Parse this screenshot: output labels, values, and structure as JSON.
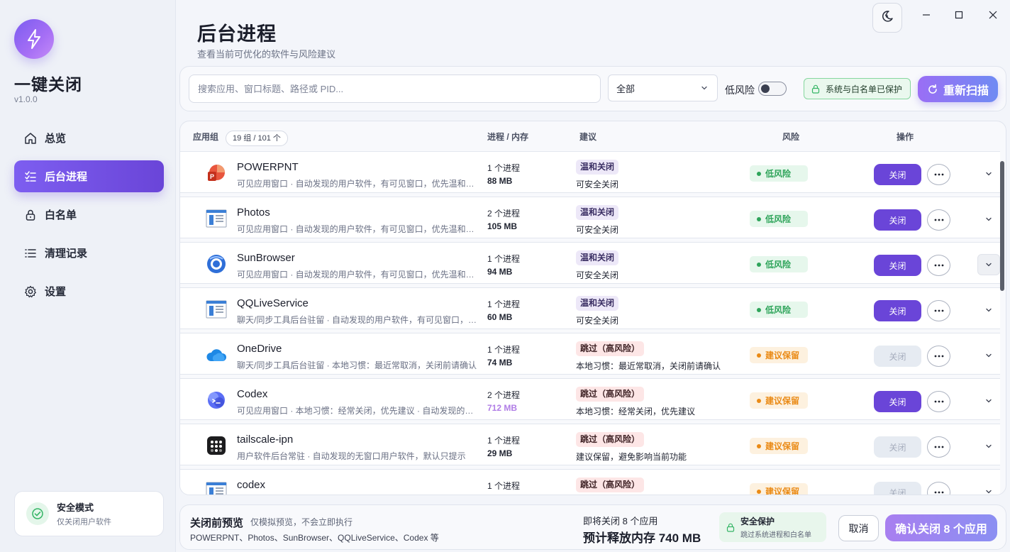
{
  "app": {
    "name": "一键关闭",
    "version": "v1.0.0"
  },
  "nav": [
    {
      "label": "总览",
      "icon": "home-icon",
      "active": false
    },
    {
      "label": "后台进程",
      "icon": "process-list-icon",
      "active": true
    },
    {
      "label": "白名单",
      "icon": "lock-icon",
      "active": false
    },
    {
      "label": "清理记录",
      "icon": "list-icon",
      "active": false
    },
    {
      "label": "设置",
      "icon": "gear-icon",
      "active": false
    }
  ],
  "safe_mode": {
    "title": "安全模式",
    "subtitle": "仅关闭用户软件"
  },
  "header": {
    "title": "后台进程",
    "subtitle": "查看当前可优化的软件与风险建议"
  },
  "filter": {
    "search_placeholder": "搜索应用、窗口标题、路径或 PID...",
    "category_selected": "全部",
    "low_risk_label": "低风险",
    "low_risk_enabled": false,
    "protection_badge": "系统与白名单已保护",
    "rescan_label": "重新扫描"
  },
  "table": {
    "headers": {
      "app_group": "应用组",
      "count": "19 组 / 101 个",
      "proc_mem": "进程 / 内存",
      "suggestion": "建议",
      "risk": "风险",
      "action": "操作"
    },
    "close_label": "关闭",
    "rows": [
      {
        "name": "POWERPNT",
        "icon": "powerpoint-icon",
        "desc": "可见应用窗口 · 自动发现的用户软件，有可见窗口，优先温和关闭",
        "procs": "1 个进程",
        "mem": "88 MB",
        "mem_highlight": false,
        "suggestion": "温和关闭",
        "suggestion_type": "gentle",
        "note": "可安全关闭",
        "risk": "低风险",
        "risk_type": "low",
        "close_enabled": true
      },
      {
        "name": "Photos",
        "icon": "app-window-icon",
        "desc": "可见应用窗口 · 自动发现的用户软件，有可见窗口，优先温和关闭",
        "procs": "2 个进程",
        "mem": "105 MB",
        "mem_highlight": false,
        "suggestion": "温和关闭",
        "suggestion_type": "gentle",
        "note": "可安全关闭",
        "risk": "低风险",
        "risk_type": "low",
        "close_enabled": true
      },
      {
        "name": "SunBrowser",
        "icon": "browser-icon",
        "desc": "可见应用窗口 · 自动发现的用户软件，有可见窗口，优先温和关闭",
        "procs": "1 个进程",
        "mem": "94 MB",
        "mem_highlight": false,
        "suggestion": "温和关闭",
        "suggestion_type": "gentle",
        "note": "可安全关闭",
        "risk": "低风险",
        "risk_type": "low",
        "close_enabled": true,
        "hover": true
      },
      {
        "name": "QQLiveService",
        "icon": "app-window-icon",
        "desc": "聊天/同步工具后台驻留 · 自动发现的用户软件，有可见窗口，优先温和关闭",
        "procs": "1 个进程",
        "mem": "60 MB",
        "mem_highlight": false,
        "suggestion": "温和关闭",
        "suggestion_type": "gentle",
        "note": "可安全关闭",
        "risk": "低风险",
        "risk_type": "low",
        "close_enabled": true
      },
      {
        "name": "OneDrive",
        "icon": "onedrive-cloud-icon",
        "desc": "聊天/同步工具后台驻留 · 本地习惯：最近常取消，关闭前请确认",
        "procs": "1 个进程",
        "mem": "74 MB",
        "mem_highlight": false,
        "suggestion": "跳过（高风险）",
        "suggestion_type": "skip",
        "note": "本地习惯：最近常取消，关闭前请确认",
        "risk": "建议保留",
        "risk_type": "keep",
        "close_enabled": false
      },
      {
        "name": "Codex",
        "icon": "codex-icon",
        "desc": "可见应用窗口 · 本地习惯：经常关闭，优先建议 · 自动发现的用户软件",
        "procs": "2 个进程",
        "mem": "712 MB",
        "mem_highlight": true,
        "suggestion": "跳过（高风险）",
        "suggestion_type": "skip",
        "note": "本地习惯：经常关闭，优先建议",
        "risk": "建议保留",
        "risk_type": "keep",
        "close_enabled": true
      },
      {
        "name": "tailscale-ipn",
        "icon": "tailscale-icon",
        "desc": "用户软件后台常驻 · 自动发现的无窗口用户软件，默认只提示",
        "procs": "1 个进程",
        "mem": "29 MB",
        "mem_highlight": false,
        "suggestion": "跳过（高风险）",
        "suggestion_type": "skip",
        "note": "建议保留，避免影响当前功能",
        "risk": "建议保留",
        "risk_type": "keep",
        "close_enabled": false
      },
      {
        "name": "codex",
        "icon": "app-window-icon",
        "desc": "",
        "procs": "1 个进程",
        "mem": "",
        "mem_highlight": false,
        "suggestion": "跳过（高风险）",
        "suggestion_type": "skip",
        "note": "",
        "risk": "建议保留",
        "risk_type": "keep",
        "close_enabled": false
      }
    ]
  },
  "footer": {
    "title": "关闭前预览",
    "subtitle": "仅模拟预览，不会立即执行",
    "apps_list": "POWERPNT、Photos、SunBrowser、QQLiveService、Codex 等",
    "count_text": "即将关闭 8 个应用",
    "free_text": "预计释放内存 740 MB",
    "protect_title": "安全保护",
    "protect_sub": "跳过系统进程和白名单",
    "cancel_label": "取消",
    "confirm_label": "确认关闭 8 个应用"
  },
  "colors": {
    "accent": "#6a45d8",
    "low_risk": "#2ea45a",
    "keep": "#ea8a15"
  }
}
